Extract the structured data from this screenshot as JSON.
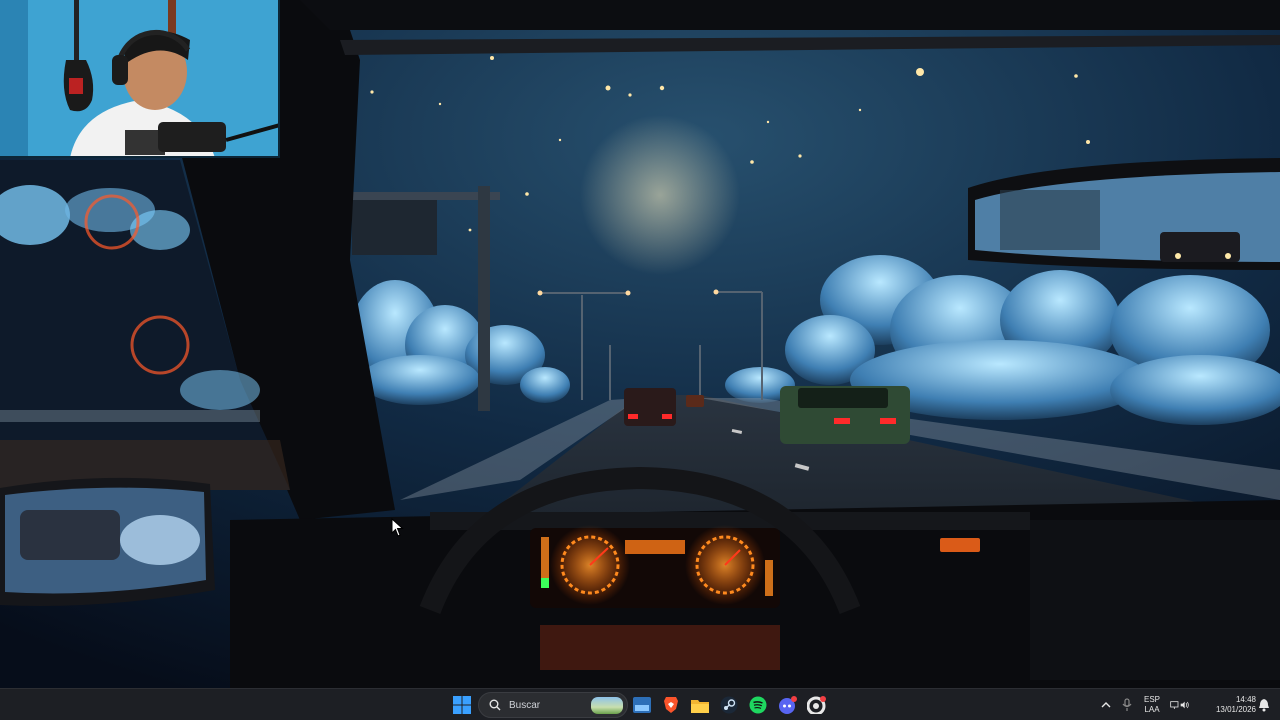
{
  "wallpaper": {
    "name": "retro-car-night-drive"
  },
  "webcam": {
    "name": "streamer-webcam-overlay"
  },
  "taskbar": {
    "search": {
      "placeholder": "Buscar"
    },
    "pinned": [
      {
        "name": "windows-start-icon"
      },
      {
        "name": "widgets-icon"
      },
      {
        "name": "brave-browser-icon"
      },
      {
        "name": "file-explorer-icon"
      },
      {
        "name": "steam-icon"
      },
      {
        "name": "spotify-icon"
      },
      {
        "name": "discord-icon"
      },
      {
        "name": "chrome-canary-icon"
      }
    ],
    "tray": {
      "language": "ESP",
      "layout": "LAA",
      "time": "14:48",
      "date": "13/01/2026"
    }
  },
  "colors": {
    "taskbar_bg": "#1d1f24",
    "accent_blue": "#3aa0ff",
    "dash_orange": "#ff8a1e"
  }
}
